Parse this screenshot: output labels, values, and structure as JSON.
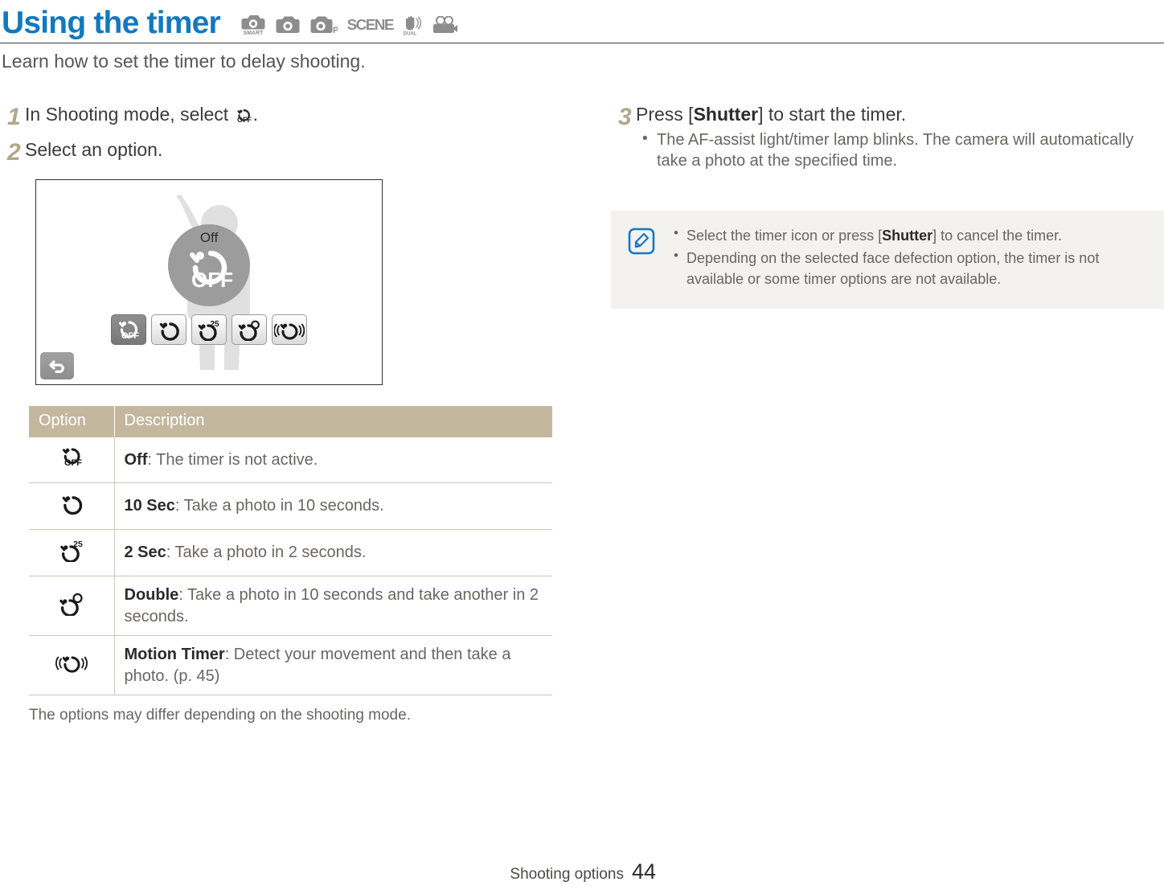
{
  "header": {
    "title": "Using the timer",
    "mode_icons": [
      {
        "name": "smart-camera-mode-icon",
        "label": "SMART"
      },
      {
        "name": "camera-mode-icon",
        "label": ""
      },
      {
        "name": "program-mode-icon",
        "label": "P"
      },
      {
        "name": "scene-mode-icon",
        "label": "SCENE"
      },
      {
        "name": "dual-is-mode-icon",
        "label": "DUAL IS"
      },
      {
        "name": "movie-mode-icon",
        "label": ""
      }
    ],
    "subtitle": "Learn how to set the timer to delay shooting.",
    "title_color": "#1478be"
  },
  "steps": {
    "step1": {
      "number": "1",
      "text_before": "In Shooting mode, select ",
      "text_after": "."
    },
    "step2": {
      "number": "2",
      "text": "Select an option."
    },
    "step3": {
      "number": "3",
      "text_before": "Press [",
      "bold": "Shutter",
      "text_after": "] to start the timer.",
      "bullets": [
        "The AF-assist light/timer lamp blinks. The camera will automatically take a photo at the specified time."
      ]
    }
  },
  "screen": {
    "selected_label": "Off",
    "back_button": "back-arrow",
    "options": [
      {
        "name": "timer-off-option",
        "selected": true
      },
      {
        "name": "timer-10sec-option",
        "selected": false
      },
      {
        "name": "timer-2sec-option",
        "selected": false
      },
      {
        "name": "timer-double-option",
        "selected": false
      },
      {
        "name": "timer-motion-option",
        "selected": false
      }
    ]
  },
  "table": {
    "headers": [
      "Option",
      "Description"
    ],
    "header_bg": "#c3b79e",
    "rows": [
      {
        "icon": "timer-off-icon",
        "term": "Off",
        "desc": ": The timer is not active."
      },
      {
        "icon": "timer-10sec-icon",
        "term": "10 Sec",
        "desc": ": Take a photo in 10 seconds."
      },
      {
        "icon": "timer-2sec-icon",
        "term": "2 Sec",
        "desc": ": Take a photo in 2 seconds."
      },
      {
        "icon": "timer-double-icon",
        "term": "Double",
        "desc": ": Take a photo in 10 seconds and take another in 2 seconds."
      },
      {
        "icon": "timer-motion-icon",
        "term": "Motion Timer",
        "desc": ": Detect your movement and then take a photo. (p. 45)"
      }
    ],
    "footnote": "The options may differ depending on the shooting mode."
  },
  "note": {
    "icon": "note-pen-icon",
    "icon_color": "#1478be",
    "bullets": [
      {
        "before": "Select the timer icon or press [",
        "bold": "Shutter",
        "after": "] to cancel the timer."
      },
      {
        "before": "Depending on the selected face defection option, the timer is not available or some timer options are not available.",
        "bold": "",
        "after": ""
      }
    ]
  },
  "footer": {
    "label": "Shooting options",
    "page": "44"
  }
}
